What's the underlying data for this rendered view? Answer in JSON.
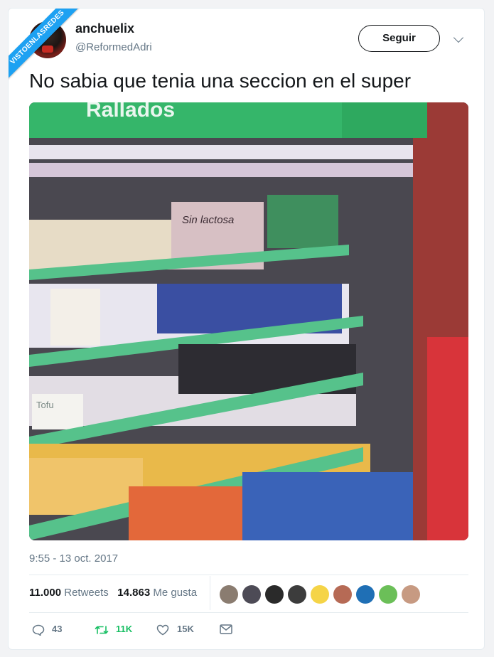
{
  "watermark": "VISTOENLASREDES",
  "user": {
    "name": "anchuelix",
    "handle": "@ReformedAdri"
  },
  "follow_label": "Seguir",
  "tweet_text": "No sabia que tenia una seccion en el super",
  "photo": {
    "sign_text": "Rallados",
    "pack_text_1": "Sin lactosa",
    "pack_text_2": "Sin lactosa",
    "tofu_label": "Tofu"
  },
  "timestamp": "9:55 - 13 oct. 2017",
  "stats": {
    "retweets_count": "11.000",
    "retweets_label": "Retweets",
    "likes_count": "14.863",
    "likes_label": "Me gusta"
  },
  "actions": {
    "reply_count": "43",
    "retweet_count": "11K",
    "like_count": "15K"
  },
  "colors": {
    "brand_blue": "#1da1f2",
    "retweet_green": "#17bf63",
    "text": "#14171a",
    "muted": "#657786"
  },
  "icons": [
    "reply-icon",
    "retweet-icon",
    "like-icon",
    "dm-icon",
    "chevron-down-icon"
  ]
}
